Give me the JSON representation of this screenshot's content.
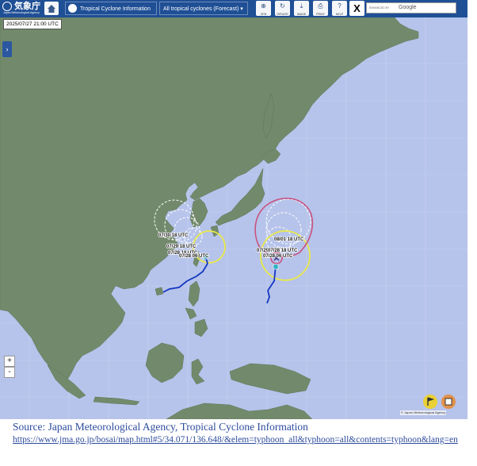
{
  "header": {
    "logo_jp": "気象庁",
    "logo_en": "Japan Meteorological Agency",
    "menu_label": "Tropical Cyclone Information",
    "selector_label": "All tropical cyclones",
    "selector_sub": "(Forecast)",
    "buttons": [
      {
        "label": "OPN",
        "icon": "open-icon"
      },
      {
        "label": "OPDATE",
        "icon": "update-icon"
      },
      {
        "label": "IMAGE",
        "icon": "image-icon"
      },
      {
        "label": "PRINT",
        "icon": "print-icon"
      },
      {
        "label": "HELP",
        "icon": "help-icon"
      }
    ],
    "x_label": "X",
    "search_prefix": "ENHANCED BY",
    "search_brand": "Google"
  },
  "map": {
    "time_label": "2025/07/27 21:00 UTC",
    "attribution": "© Japan Meteorological Agency",
    "colors": {
      "sea": "#b6c3ea",
      "land": "#728a6b",
      "forecast_circle": "#e9e94a",
      "storm_circle": "#c9517e",
      "track": "#1538c2",
      "probability_circle": "#ffffff"
    },
    "storm_west": {
      "forecast_labels": [
        "07/30 18 UTC",
        "07/29 18 UTC",
        "07/28 18 UTC",
        "07/28 06 UTC"
      ]
    },
    "storm_east": {
      "forecast_labels": [
        "08/01 18 UTC",
        "07/29 18 UTC",
        "07/28 18 UTC",
        "07/28 06 UTC"
      ]
    }
  },
  "controls": {
    "side_toggle": "›",
    "zoom_in": "+",
    "zoom_out": "-"
  },
  "caption": {
    "source": "Source: Japan Meteorological  Agency, Tropical Cyclone Information",
    "url": "https://www.jma.go.jp/bosai/map.html#5/34.071/136.648/&elem=typhoon_all&typhoon=all&contents=typhoon&lang=en"
  }
}
